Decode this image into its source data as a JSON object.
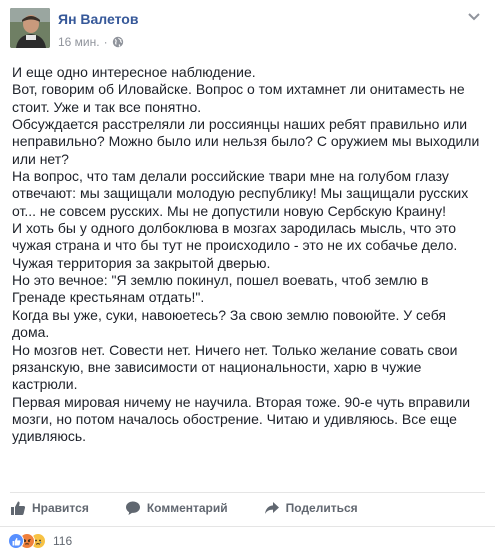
{
  "post": {
    "author": "Ян Валетов",
    "time": "16 мин.",
    "paragraphs": [
      "И еще одно интересное наблюдение.",
      "Вот, говорим об Иловайске. Вопрос о том ихтамнет ли онитаместь не стоит. Уже и так все понятно.",
      "Обсуждается расстреляли ли россиянцы наших ребят правильно или неправильно? Можно было или нельзя было? С оружием мы выходили или нет?",
      "На вопрос, что там делали российские твари мне на голубом глазу отвечают: мы защищали молодую республику! Мы защищали русских от... не совсем русских. Мы не допустили новую Сербскую Краину!",
      "И хоть бы у одного долбоклюва в мозгах зародилась мысль, что это чужая страна и что бы тут не происходило - это не их собачье дело. Чужая территория за закрытой дверью.",
      "Но это вечное: \"Я землю покинул, пошел воевать, чтоб землю в Гренаде крестьянам отдать!\".",
      "Когда вы уже, суки, навоюетесь? За свою землю повоюйте. У себя дома.",
      "Но мозгов нет. Совести нет. Ничего нет. Только желание совать свои рязанскую, вне зависимости от национальности, харю в чужие кастрюли.",
      "Первая мировая ничему не научила. Вторая тоже. 90-е чуть вправили мозги, но потом началось обострение. Читаю и удивляюсь. Все еще удивляюсь."
    ]
  },
  "actions": {
    "like": "Нравится",
    "comment": "Комментарий",
    "share": "Поделиться"
  },
  "reactions": {
    "count": "116",
    "types": [
      "like-icon",
      "angry-icon",
      "sad-icon"
    ]
  },
  "colors": {
    "author": "#365899",
    "meta": "#90949c",
    "action": "#616770",
    "like_blue": "#5890ff",
    "angry_orange": "#f0803c",
    "sad_yellow": "#f7c244"
  }
}
